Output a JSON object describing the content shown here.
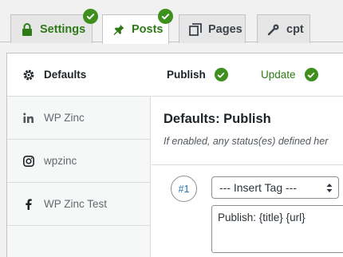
{
  "tabs": [
    {
      "label": "Settings",
      "icon": "lock-icon",
      "checked": true
    },
    {
      "label": "Posts",
      "icon": "pushpin-icon",
      "checked": true,
      "active": true
    },
    {
      "label": "Pages",
      "icon": "pages-icon",
      "checked": false
    },
    {
      "label": "cpt",
      "icon": "wrench-icon",
      "checked": false
    }
  ],
  "sidebar": {
    "items": [
      {
        "label": "Defaults",
        "icon": "gear-icon"
      },
      {
        "label": "WP Zinc",
        "icon": "linkedin-icon"
      },
      {
        "label": "wpzinc",
        "icon": "instagram-icon"
      },
      {
        "label": "WP Zinc Test",
        "icon": "facebook-icon"
      }
    ]
  },
  "subtabs": [
    {
      "label": "Publish",
      "checked": true
    },
    {
      "label": "Update",
      "checked": true
    }
  ],
  "main": {
    "heading": "Defaults: Publish",
    "description": "If enabled, any status(es) defined her",
    "status_number": "#1",
    "insert_tag_value": "--- Insert Tag ---",
    "message_text": "Publish: {title} {url}"
  },
  "colors": {
    "accent_green": "#2d7a16",
    "check_green": "#3d8f1e",
    "link_blue": "#2271b1"
  }
}
